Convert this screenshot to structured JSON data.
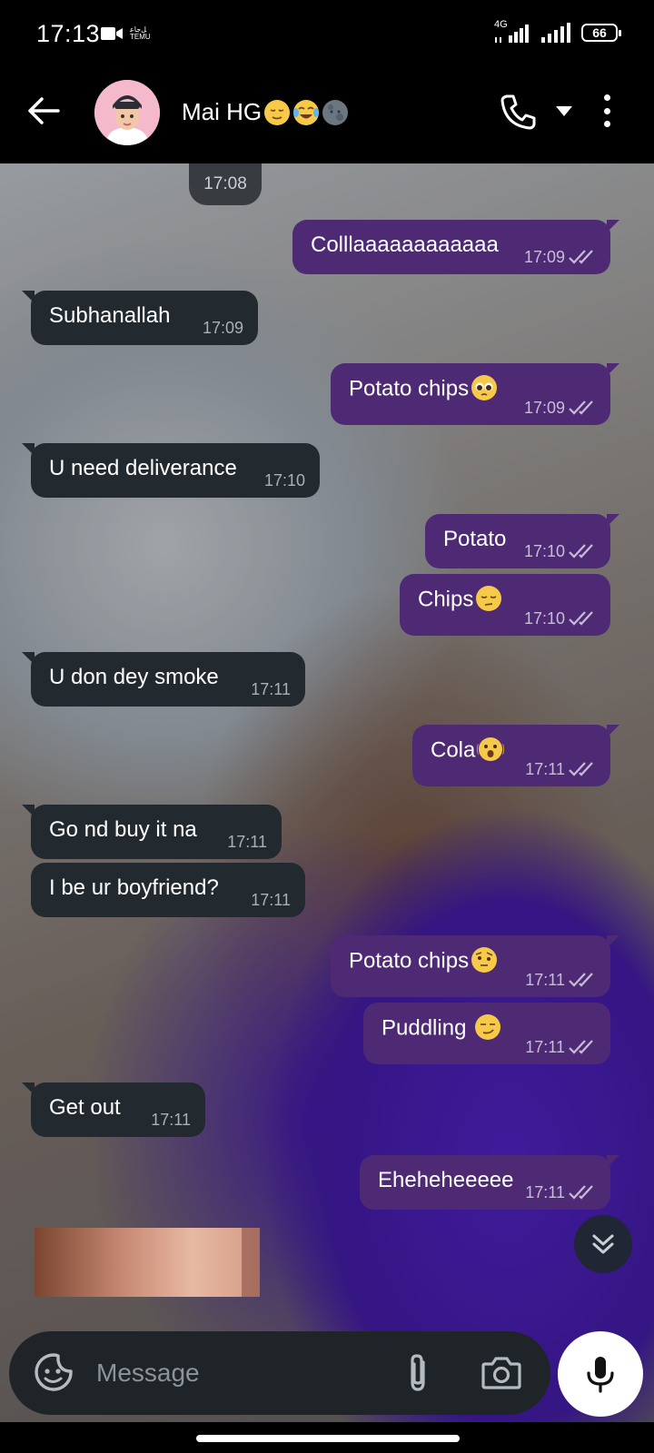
{
  "status_bar": {
    "time": "17:13",
    "left_labels": [
      "ﻞﺟﺎﻋ",
      "TEMU"
    ],
    "network_label": "4G",
    "battery": "66"
  },
  "header": {
    "contact_name": "Mai HG",
    "name_emojis": [
      "relieved-face",
      "tears-of-joy-face",
      "new-moon-face"
    ],
    "accent_color": "#4e2a74"
  },
  "chat": {
    "date_chip": "17:08",
    "messages": [
      {
        "dir": "out",
        "text": "Colllaaaaaaaaaaaa",
        "time": "17:09",
        "status": "read"
      },
      {
        "dir": "in",
        "text": "Subhanallah",
        "time": "17:09"
      },
      {
        "dir": "out",
        "text": "Potato chips",
        "emoji": "pleading-face",
        "time": "17:09",
        "status": "read"
      },
      {
        "dir": "in",
        "text": "U need deliverance",
        "time": "17:10"
      },
      {
        "dir": "out",
        "text": "Potato",
        "time": "17:10",
        "status": "read"
      },
      {
        "dir": "out",
        "text": "Chips",
        "emoji": "pensive-face",
        "time": "17:10",
        "status": "read"
      },
      {
        "dir": "in",
        "text": "U don dey smoke",
        "time": "17:11"
      },
      {
        "dir": "out",
        "text": "Cola",
        "emoji": "shaking-face",
        "time": "17:11",
        "status": "read"
      },
      {
        "dir": "in",
        "text": "Go nd buy it na",
        "time": "17:11"
      },
      {
        "dir": "in",
        "text": "I be ur boyfriend?",
        "time": "17:11"
      },
      {
        "dir": "out",
        "text": "Potato chips",
        "emoji": "face-with-raised-eyebrow",
        "time": "17:11",
        "status": "read"
      },
      {
        "dir": "out",
        "text": "Puddling ",
        "emoji": "smirking-face",
        "time": "17:11",
        "status": "read"
      },
      {
        "dir": "in",
        "text": "Get out",
        "time": "17:11"
      },
      {
        "dir": "out",
        "text": "Eheheheeeee",
        "time": "17:11",
        "status": "read"
      }
    ]
  },
  "input": {
    "placeholder": "Message"
  }
}
